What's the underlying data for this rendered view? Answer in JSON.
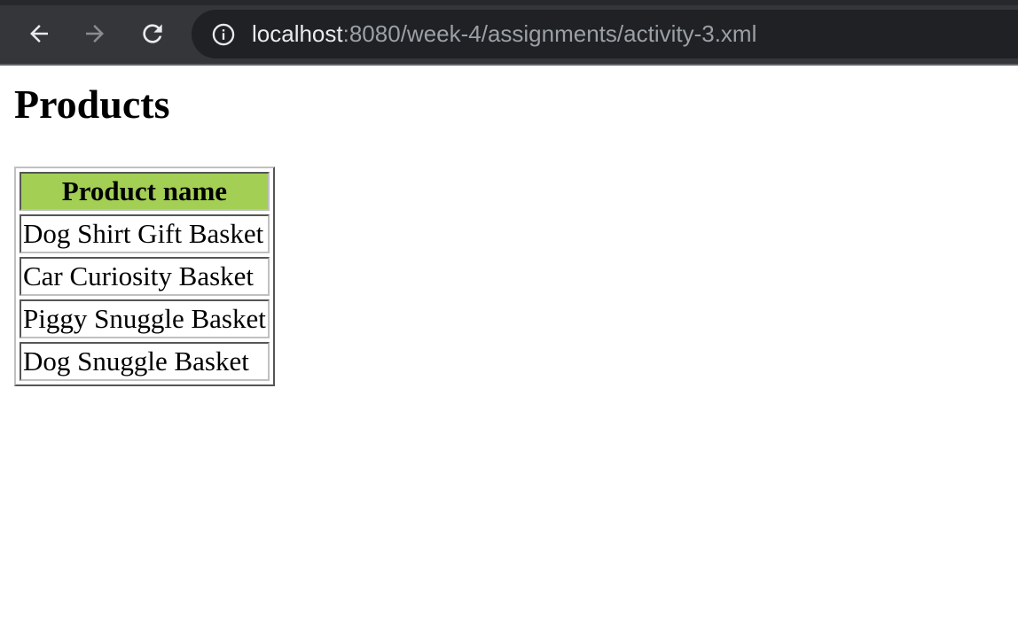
{
  "browser": {
    "url_host": "localhost",
    "url_rest": ":8080/week-4/assignments/activity-3.xml",
    "icons": {
      "back": "arrow-left-icon",
      "forward": "arrow-right-icon",
      "reload": "reload-icon",
      "site_info": "info-icon"
    }
  },
  "page": {
    "title": "Products",
    "table": {
      "header": "Product name",
      "header_bg": "#a3cf55",
      "rows": [
        "Dog Shirt Gift Basket",
        "Car Curiosity Basket",
        "Piggy Snuggle Basket",
        "Dog Snuggle Basket"
      ]
    }
  }
}
